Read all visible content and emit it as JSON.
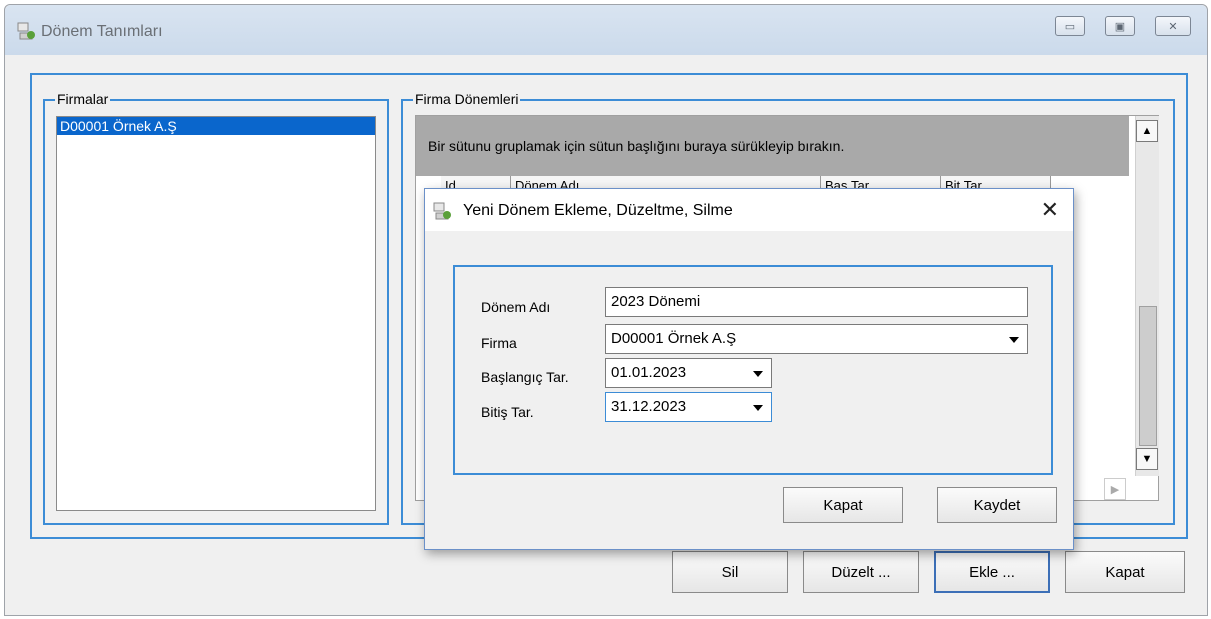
{
  "main_window": {
    "title": "Dönem Tanımları",
    "controls": {
      "minimize": "▭",
      "maximize": "▣",
      "close": "✕"
    }
  },
  "firmalar": {
    "label": "Firmalar",
    "items": [
      "D00001  Örnek A.Ş"
    ]
  },
  "firma_donemleri": {
    "label": "Firma Dönemleri",
    "group_panel_text": "Bir sütunu gruplamak için sütun başlığını buraya sürükleyip bırakın.",
    "columns": [
      "Id",
      "Dönem Adı",
      "Baş.Tar.",
      "Bit.Tar."
    ]
  },
  "bottom_buttons": {
    "sil": "Sil",
    "duzelt": "Düzelt ...",
    "ekle": "Ekle ...",
    "kapat": "Kapat"
  },
  "dialog": {
    "title": "Yeni Dönem Ekleme, Düzeltme, Silme",
    "close": "✕",
    "fields": {
      "donem_adi": {
        "label": "Dönem Adı",
        "value": "2023 Dönemi"
      },
      "firma": {
        "label": "Firma",
        "value": "D00001  Örnek A.Ş"
      },
      "baslangic": {
        "label": "Başlangıç Tar.",
        "value": "01.01.2023"
      },
      "bitis": {
        "label": "Bitiş Tar.",
        "value": "31.12.2023"
      }
    },
    "buttons": {
      "kapat": "Kapat",
      "kaydet": "Kaydet"
    }
  },
  "colors": {
    "accent": "#3c8cd6",
    "selection": "#0a66cc",
    "group_panel": "#a9a9a9"
  }
}
